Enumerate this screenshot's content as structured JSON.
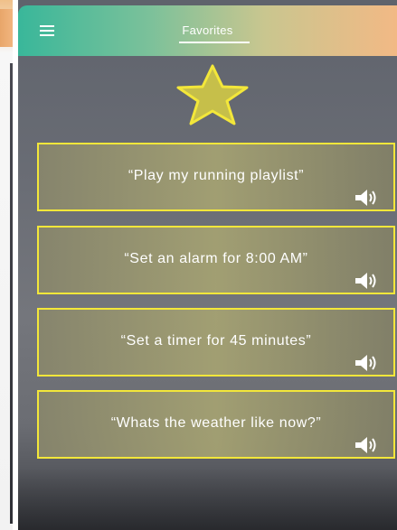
{
  "header": {
    "title": "Favorites",
    "menu_icon": "hamburger-menu-icon"
  },
  "hero": {
    "icon": "star-icon",
    "accent_color": "#f3e73a"
  },
  "favorites": [
    {
      "phrase": "“Play my running playlist”",
      "speaker_icon": "speaker-icon"
    },
    {
      "phrase": "“Set an alarm for 8:00 AM”",
      "speaker_icon": "speaker-icon"
    },
    {
      "phrase": "“Set a timer for 45 minutes”",
      "speaker_icon": "speaker-icon"
    },
    {
      "phrase": "“Whats the weather like now?”",
      "speaker_icon": "speaker-icon"
    }
  ],
  "colors": {
    "header_start": "#39b79a",
    "header_end": "#f2b985",
    "card_border": "#f3e73a",
    "background": "#6a6d75"
  }
}
